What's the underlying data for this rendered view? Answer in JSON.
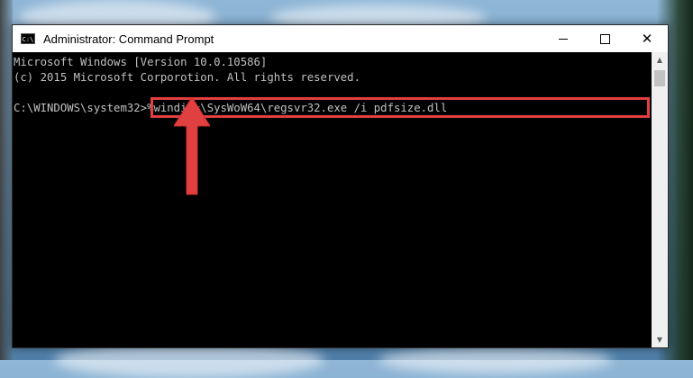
{
  "window": {
    "title": "Administrator: Command Prompt",
    "icon_text": "C:\\",
    "controls": {
      "minimize_icon": "minimize-icon",
      "maximize_icon": "maximize-icon",
      "close_icon": "close-icon",
      "close_glyph": "✕"
    }
  },
  "console": {
    "lines": [
      "Microsoft Windows [Version 10.0.10586]",
      "(c) 2015 Microsoft Corporotion. All rights reserved.",
      "C:\\WINDOWS\\system32>%windir%\\SysWoW64\\regsvr32.exe /i pdfsize.dll"
    ],
    "highlight_color": "#e04040",
    "text_color": "#c0c0c0",
    "background_color": "#000000"
  },
  "annotation": {
    "arrow_color": "#e04040",
    "arrow_icon": "up-arrow-icon"
  },
  "scrollbar": {
    "up_glyph": "▲",
    "down_glyph": "▼"
  }
}
